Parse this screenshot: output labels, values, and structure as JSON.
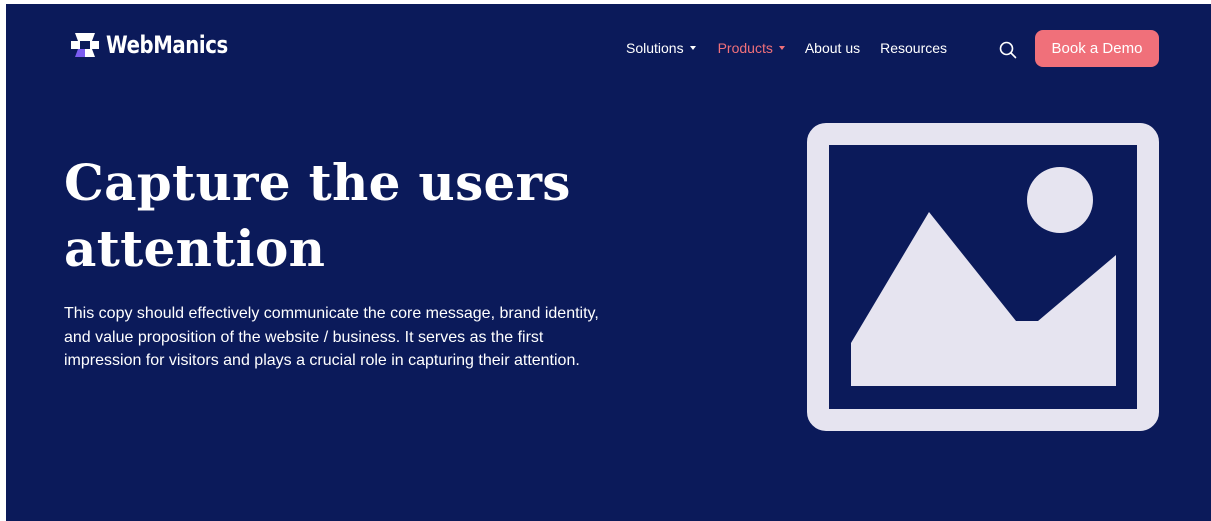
{
  "brand": {
    "name": "WebManics",
    "logo_icon": "webmanics-logo-icon"
  },
  "nav": {
    "items": [
      {
        "label": "Solutions",
        "has_dropdown": true,
        "active": false
      },
      {
        "label": "Products",
        "has_dropdown": true,
        "active": true
      },
      {
        "label": "About us",
        "has_dropdown": false,
        "active": false
      },
      {
        "label": "Resources",
        "has_dropdown": false,
        "active": false
      }
    ],
    "search_icon": "search-icon",
    "cta_label": "Book a Demo"
  },
  "hero": {
    "headline": "Capture the users attention",
    "body": "This copy should effectively communicate the core message, brand identity, and value proposition of the website / business. It serves as the first impression for visitors and plays a crucial role in capturing their attention.",
    "image_icon": "image-placeholder-icon"
  },
  "colors": {
    "background": "#0b1a5a",
    "accent": "#f0707a",
    "text": "#ffffff",
    "placeholder": "#e6e4f0",
    "logo_purple": "#7b5cf0"
  }
}
